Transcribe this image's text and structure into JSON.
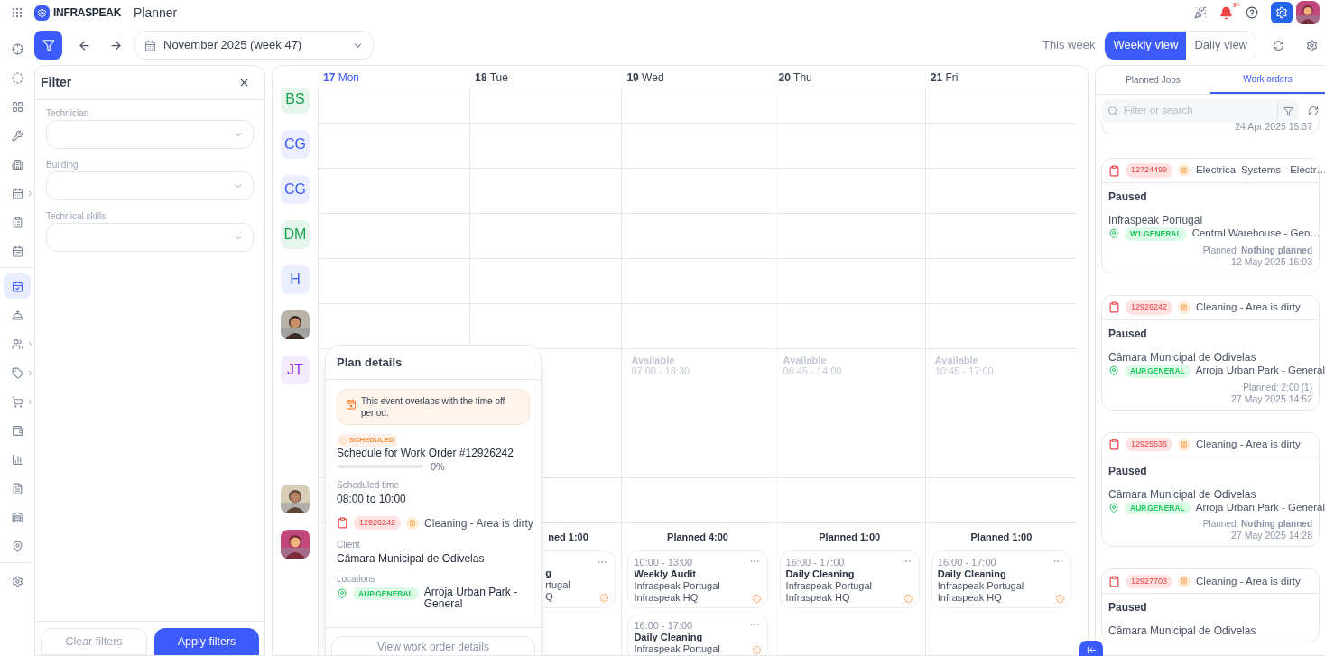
{
  "app": {
    "logo": "INFRASPEAK",
    "title": "Planner",
    "notification_badge": "9+"
  },
  "nav_groups": [
    {
      "items": [
        {
          "selected": false,
          "submenu": false
        },
        {
          "selected": false,
          "submenu": false
        },
        {
          "selected": false,
          "submenu": false
        },
        {
          "selected": false,
          "submenu": false
        },
        {
          "selected": false,
          "submenu": false
        },
        {
          "selected": false,
          "submenu": true
        },
        {
          "selected": false,
          "submenu": false
        },
        {
          "selected": false,
          "submenu": false
        }
      ]
    },
    {
      "items": [
        {
          "selected": true,
          "submenu": false
        },
        {
          "selected": false,
          "submenu": false
        },
        {
          "selected": false,
          "submenu": true
        },
        {
          "selected": false,
          "submenu": true
        },
        {
          "selected": false,
          "submenu": true
        },
        {
          "selected": false,
          "submenu": false
        },
        {
          "selected": false,
          "submenu": false
        },
        {
          "selected": false,
          "submenu": false
        },
        {
          "selected": false,
          "submenu": false
        },
        {
          "selected": false,
          "submenu": false
        }
      ]
    },
    {
      "items": [
        {
          "selected": false,
          "submenu": false
        }
      ]
    }
  ],
  "toolbar": {
    "filter_active": true,
    "period": "November 2025 (week 47)",
    "this_week": "This week",
    "views": [
      {
        "label": "Weekly view",
        "selected": true
      },
      {
        "label": "Daily view",
        "selected": false
      }
    ]
  },
  "filter": {
    "title": "Filter",
    "fields": [
      {
        "label": "Technician"
      },
      {
        "label": "Building"
      },
      {
        "label": "Technical skills"
      }
    ],
    "buttons": [
      {
        "label": "Clear filters",
        "kind": "secondary"
      },
      {
        "label": "Apply filters",
        "kind": "primary"
      }
    ]
  },
  "calendar": {
    "days": [
      {
        "date": "17",
        "weekday": "Mon",
        "today": true
      },
      {
        "date": "18",
        "weekday": "Tue",
        "today": false
      },
      {
        "date": "19",
        "weekday": "Wed",
        "today": false
      },
      {
        "date": "20",
        "weekday": "Thu",
        "today": false
      },
      {
        "date": "21",
        "weekday": "Fri",
        "today": false
      }
    ],
    "rows": [
      {
        "avatar": {
          "kind": "initials",
          "text": "BS",
          "color": "#16a34a"
        },
        "cells": [
          {},
          {},
          {},
          {},
          {}
        ]
      },
      {
        "avatar": {
          "kind": "initials",
          "text": "CG",
          "color": "#3b5bfd"
        },
        "cells": [
          {},
          {},
          {},
          {},
          {}
        ]
      },
      {
        "avatar": {
          "kind": "initials",
          "text": "CG",
          "color": "#3b5bfd"
        },
        "cells": [
          {},
          {},
          {},
          {},
          {}
        ]
      },
      {
        "avatar": {
          "kind": "initials",
          "text": "DM",
          "color": "#16a34a"
        },
        "cells": [
          {},
          {},
          {},
          {},
          {}
        ]
      },
      {
        "avatar": {
          "kind": "initials",
          "text": "H",
          "color": "#3b5bfd"
        },
        "cells": [
          {},
          {},
          {},
          {},
          {}
        ]
      },
      {
        "cells": [
          {},
          {},
          {},
          {},
          {}
        ]
      },
      {
        "avatar": {
          "kind": "initials",
          "text": "JT",
          "color": "#9333ea"
        },
        "cells": [
          {},
          {},
          {
            "available": "Available",
            "hours": "07:00 - 18:30"
          },
          {
            "available": "Available",
            "hours": "06:45 - 14:00"
          },
          {
            "available": "Available",
            "hours": "10:45 - 17:00"
          }
        ]
      },
      {
        "cells": [
          {},
          {},
          {},
          {},
          {}
        ]
      },
      {
        "cells": [
          {},
          {
            "planned": "ned 1:00",
            "events": [
              {
                "kind": "partial",
                "lines": [
                  "g",
                  "rtugal",
                  "Q"
                ]
              }
            ]
          },
          {
            "planned": "Planned 4:00",
            "events": [
              {
                "kind": "full",
                "time": "10:00 - 13:00",
                "title": "Weekly Audit",
                "client": "Infraspeak Portugal",
                "site": "Infraspeak HQ"
              },
              {
                "kind": "full",
                "time": "16:00 - 17:00",
                "title": "Daily Cleaning",
                "client": "Infraspeak Portugal"
              }
            ]
          },
          {
            "planned": "Planned 1:00",
            "events": [
              {
                "kind": "full",
                "time": "16:00 - 17:00",
                "title": "Daily Cleaning",
                "client": "Infraspeak Portugal",
                "site": "Infraspeak HQ"
              }
            ]
          },
          {
            "planned": "Planned 1:00",
            "events": [
              {
                "kind": "full",
                "time": "16:00 - 17:00",
                "title": "Daily Cleaning",
                "client": "Infraspeak Portugal",
                "site": "Infraspeak HQ"
              }
            ]
          }
        ]
      }
    ]
  },
  "plan_details": {
    "title": "Plan details",
    "warning": "This event overlaps with the time off period.",
    "status": "SCHEDULED",
    "heading": "Schedule for Work Order #12926242",
    "progress": {
      "level": 0,
      "reading": "0%"
    },
    "time_label": "Scheduled time",
    "time": "08:00 to 10:00",
    "work_order": {
      "id": "12926242",
      "title": "Cleaning - Area is dirty"
    },
    "client_label": "Client",
    "client": "Câmara Municipal de Odivelas",
    "locations_label": "Locations",
    "location": {
      "code": "AUP.GENERAL",
      "name": "Arroja Urban Park - General"
    },
    "button": "View work order details"
  },
  "side_panel": {
    "tabs": [
      {
        "label": "Planned Jobs",
        "selected": false
      },
      {
        "label": "Work orders",
        "selected": true
      }
    ],
    "search": {
      "placeholder": "Filter or search"
    },
    "cards": [
      {
        "kind": "tail",
        "date": "24 Apr 2025 15:37"
      },
      {
        "kind": "full",
        "id": "12724499",
        "title": "Electrical Systems - Electr…",
        "status": "Paused",
        "client": "Infraspeak Portugal",
        "location_code": "W1.GENERAL",
        "location": "Central Warehouse - Gen…",
        "planned": "Planned: **Nothing planned**",
        "date": "12 May 2025 16:03"
      },
      {
        "kind": "full",
        "id": "12926242",
        "title": "Cleaning - Area is dirty",
        "status": "Paused",
        "client": "Câmara Municipal de Odivelas",
        "location_code": "AUP.GENERAL",
        "location": "Arroja Urban Park - General",
        "planned": "Planned: 2:00 (1)",
        "date": "27 May 2025 14:52"
      },
      {
        "kind": "full",
        "id": "12925536",
        "title": "Cleaning - Area is dirty",
        "status": "Paused",
        "client": "Câmara Municipal de Odivelas",
        "location_code": "AUP.GENERAL",
        "location": "Arroja Urban Park - General",
        "planned": "Planned: **Nothing planned**",
        "date": "27 May 2025 14:28"
      },
      {
        "kind": "full",
        "id": "12927703",
        "title": "Cleaning - Area is dirty",
        "status": "Paused",
        "client": "Câmara Municipal de Odivelas"
      }
    ]
  }
}
